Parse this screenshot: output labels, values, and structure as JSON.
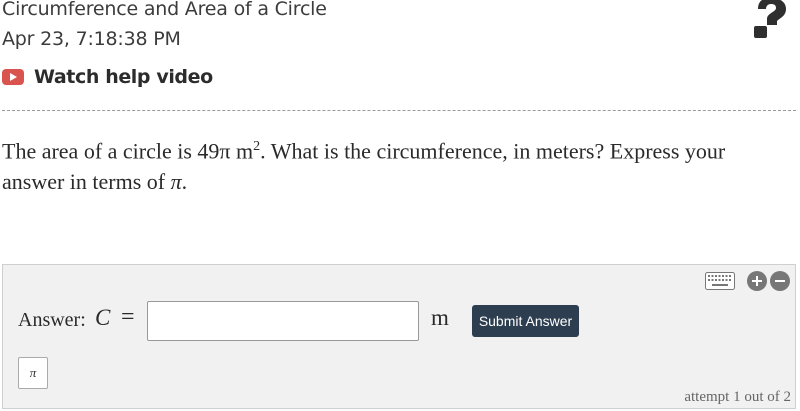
{
  "header": {
    "title": "Circumference and Area of a Circle",
    "datetime": "Apr 23, 7:18:38 PM",
    "help_link_label": "Watch help video"
  },
  "icons": {
    "help_link": "youtube-play-icon",
    "corner": "question-mark-icon",
    "keyboard": "keyboard-icon",
    "zoom_in": "plus-circle-icon",
    "zoom_out": "minus-circle-icon"
  },
  "question": {
    "part1": "The area of a circle is 49π m",
    "sup": "2",
    "part2": ". What is the circumference, in meters? Express your answer in terms of ",
    "pi": "π",
    "part3": "."
  },
  "answer": {
    "label": "Answer:",
    "variable": "C",
    "equals": "=",
    "input_value": "",
    "unit": "m",
    "submit_label": "Submit Answer",
    "pi_button": "π",
    "attempt_text": "attempt 1 out of 2"
  },
  "colors": {
    "submit_bg": "#2d3e50",
    "youtube_red": "#d9534f",
    "panel_bg": "#f1f1f1"
  }
}
